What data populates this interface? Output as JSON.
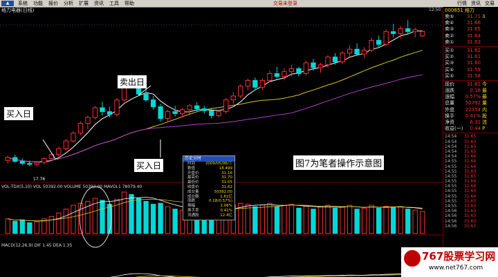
{
  "menu": {
    "items": [
      "系统",
      "功能",
      "报价",
      "分析",
      "扩展",
      "资讯",
      "工具",
      "帮助"
    ],
    "center_text": "交易未登录",
    "right": [
      "行情",
      "资讯",
      "交易"
    ]
  },
  "window": {
    "title": "格力电器(日线)",
    "time": "12:50"
  },
  "indicators": {
    "volume_label": "VOL-TDX(5,10)  VOL 50392.00  VOLUME 50392.00  MAVOL1 78079.40",
    "macd_label": "MACD(12,26,9)  DIF 1.45  DEA 1.35"
  },
  "annotations": {
    "buy1": "买入日",
    "sell": "卖出日",
    "buy2": "买入日",
    "caption": "图7为笔者操作示意图",
    "low_price": "17.76"
  },
  "quote_panel": {
    "code": "000651 格力",
    "rows": [
      {
        "label": "卖⑤",
        "value": "31.71",
        "vol": "3"
      },
      {
        "label": "卖④",
        "value": "31.66",
        "vol": ""
      },
      {
        "label": "卖③",
        "value": "31.65",
        "vol": ""
      },
      {
        "label": "卖②",
        "value": "31.64",
        "vol": ""
      },
      {
        "label": "卖①",
        "value": "31.63",
        "vol": ""
      },
      {
        "label": "买①",
        "value": "31.62",
        "vol": ""
      },
      {
        "label": "买②",
        "value": "31.61",
        "vol": ""
      },
      {
        "label": "买③",
        "value": "31.60",
        "vol": ""
      },
      {
        "label": "买④",
        "value": "31.59",
        "vol": ""
      },
      {
        "label": "买⑤",
        "value": "31.58",
        "vol": ""
      },
      {
        "label": "现价",
        "value": "31.62",
        "vol": "今"
      },
      {
        "label": "涨跌",
        "value": "0.18",
        "vol": "最"
      },
      {
        "label": "涨幅",
        "value": "0.57%",
        "vol": "最"
      },
      {
        "label": "总量",
        "value": "50392",
        "vol": "量"
      },
      {
        "label": "外盘",
        "value": "22354",
        "vol": "内"
      },
      {
        "label": "换手",
        "value": "0.41%",
        "vol": "股"
      },
      {
        "label": "净资",
        "value": "6.31",
        "vol": "流"
      },
      {
        "label": "收益(一)",
        "value": "0.44",
        "vol": "P"
      }
    ],
    "ticks": [
      {
        "time": "14:54",
        "price": "31.65"
      },
      {
        "time": "14:54",
        "price": "31.63"
      },
      {
        "time": "14:54",
        "price": "31.65"
      },
      {
        "time": "14:54",
        "price": "31.65"
      },
      {
        "time": "14:54",
        "price": "31.64"
      },
      {
        "time": "14:55",
        "price": "31.64"
      },
      {
        "time": "14:55",
        "price": "31.64"
      },
      {
        "time": "14:55",
        "price": "31.63"
      },
      {
        "time": "14:55",
        "price": "31.65"
      },
      {
        "time": "14:55",
        "price": "31.64"
      },
      {
        "time": "14:55",
        "price": "31.64"
      },
      {
        "time": "14:55",
        "price": "31.63"
      },
      {
        "time": "14:55",
        "price": "31.64"
      },
      {
        "time": "14:55",
        "price": "31.63"
      },
      {
        "time": "14:55",
        "price": "31.63"
      },
      {
        "time": "14:56",
        "price": "31.63"
      },
      {
        "time": "14:56",
        "price": "31.63"
      },
      {
        "time": "14:56",
        "price": "31.63"
      },
      {
        "time": "14:56",
        "price": "31.63"
      }
    ]
  },
  "popup": {
    "title": "历史分时",
    "rows": [
      {
        "label": "时间",
        "value": "2009/05/06/三"
      },
      {
        "label": "数值",
        "value": "18.499"
      },
      {
        "label": "开盘价",
        "value": "31.16"
      },
      {
        "label": "最高价",
        "value": "31.70"
      },
      {
        "label": "最低价",
        "value": "31.05"
      },
      {
        "label": "收盘价",
        "value": "31.62"
      },
      {
        "label": "成交量",
        "value": "50392.00"
      },
      {
        "label": "成交额",
        "value": "1.61亿"
      },
      {
        "label": "涨跌",
        "value": "0.18(0.57%)"
      },
      {
        "label": "振幅",
        "value": "2.06%"
      },
      {
        "label": "换手率",
        "value": "0.41%"
      },
      {
        "label": "流通股",
        "value": "12.4亿"
      }
    ]
  },
  "watermark": {
    "title": "767股票学习网",
    "url": "www.net767.com"
  },
  "colors": {
    "up": "#ff3030",
    "down": "#00d8d8",
    "ma_white": "#ffffff",
    "ma_yellow": "#d8c820",
    "ma_purple": "#b040d0"
  },
  "chart_data": {
    "type": "candlestick",
    "candles": [
      {
        "open": 18.4,
        "high": 18.9,
        "low": 18.1,
        "close": 18.7
      },
      {
        "open": 18.7,
        "high": 19.0,
        "low": 18.2,
        "close": 18.3
      },
      {
        "open": 18.3,
        "high": 18.6,
        "low": 17.9,
        "close": 18.1
      },
      {
        "open": 18.1,
        "high": 18.4,
        "low": 17.8,
        "close": 18.0
      },
      {
        "open": 18.0,
        "high": 18.3,
        "low": 17.76,
        "close": 18.2
      },
      {
        "open": 18.2,
        "high": 18.7,
        "low": 18.0,
        "close": 18.6
      },
      {
        "open": 18.6,
        "high": 19.2,
        "low": 18.4,
        "close": 19.0
      },
      {
        "open": 19.0,
        "high": 19.8,
        "low": 18.8,
        "close": 19.6
      },
      {
        "open": 19.6,
        "high": 20.6,
        "low": 19.4,
        "close": 20.4
      },
      {
        "open": 20.4,
        "high": 21.4,
        "low": 20.2,
        "close": 21.2
      },
      {
        "open": 21.2,
        "high": 22.4,
        "low": 21.0,
        "close": 22.2
      },
      {
        "open": 22.2,
        "high": 23.0,
        "low": 21.6,
        "close": 22.8
      },
      {
        "open": 22.8,
        "high": 24.0,
        "low": 22.6,
        "close": 23.8
      },
      {
        "open": 23.8,
        "high": 24.4,
        "low": 23.0,
        "close": 23.4
      },
      {
        "open": 23.4,
        "high": 23.9,
        "low": 22.8,
        "close": 23.1
      },
      {
        "open": 23.1,
        "high": 24.8,
        "low": 22.9,
        "close": 24.6
      },
      {
        "open": 24.6,
        "high": 26.6,
        "low": 24.4,
        "close": 26.3
      },
      {
        "open": 26.3,
        "high": 27.2,
        "low": 25.8,
        "close": 26.0
      },
      {
        "open": 26.0,
        "high": 26.4,
        "low": 25.0,
        "close": 25.2
      },
      {
        "open": 25.2,
        "high": 25.8,
        "low": 24.4,
        "close": 24.6
      },
      {
        "open": 24.6,
        "high": 25.0,
        "low": 23.6,
        "close": 23.9
      },
      {
        "open": 23.9,
        "high": 24.2,
        "low": 22.4,
        "close": 22.7
      },
      {
        "open": 22.7,
        "high": 23.6,
        "low": 22.4,
        "close": 23.4
      },
      {
        "open": 23.4,
        "high": 24.0,
        "low": 22.9,
        "close": 23.2
      },
      {
        "open": 23.2,
        "high": 23.8,
        "low": 22.8,
        "close": 23.6
      },
      {
        "open": 23.6,
        "high": 24.2,
        "low": 23.2,
        "close": 24.0
      },
      {
        "open": 24.0,
        "high": 24.4,
        "low": 23.4,
        "close": 23.7
      },
      {
        "open": 23.7,
        "high": 24.0,
        "low": 23.2,
        "close": 23.5
      },
      {
        "open": 23.5,
        "high": 23.8,
        "low": 22.7,
        "close": 23.0
      },
      {
        "open": 23.0,
        "high": 23.6,
        "low": 22.8,
        "close": 23.4
      },
      {
        "open": 23.4,
        "high": 24.8,
        "low": 23.2,
        "close": 24.6
      },
      {
        "open": 24.6,
        "high": 25.4,
        "low": 24.2,
        "close": 25.0
      },
      {
        "open": 25.0,
        "high": 26.2,
        "low": 24.8,
        "close": 26.0
      },
      {
        "open": 26.0,
        "high": 26.8,
        "low": 25.6,
        "close": 26.6
      },
      {
        "open": 26.6,
        "high": 26.9,
        "low": 25.6,
        "close": 25.9
      },
      {
        "open": 25.9,
        "high": 26.8,
        "low": 25.6,
        "close": 26.6
      },
      {
        "open": 26.6,
        "high": 27.6,
        "low": 26.4,
        "close": 27.3
      },
      {
        "open": 27.3,
        "high": 28.0,
        "low": 26.8,
        "close": 27.0
      },
      {
        "open": 27.0,
        "high": 27.8,
        "low": 26.6,
        "close": 27.5
      },
      {
        "open": 27.5,
        "high": 28.2,
        "low": 27.0,
        "close": 27.8
      },
      {
        "open": 27.8,
        "high": 28.0,
        "low": 27.0,
        "close": 27.3
      },
      {
        "open": 27.3,
        "high": 28.6,
        "low": 27.1,
        "close": 28.4
      },
      {
        "open": 28.4,
        "high": 28.8,
        "low": 27.6,
        "close": 27.9
      },
      {
        "open": 27.9,
        "high": 28.4,
        "low": 27.4,
        "close": 28.2
      },
      {
        "open": 28.2,
        "high": 29.2,
        "low": 27.9,
        "close": 29.0
      },
      {
        "open": 29.0,
        "high": 29.4,
        "low": 28.2,
        "close": 28.5
      },
      {
        "open": 28.5,
        "high": 29.6,
        "low": 28.3,
        "close": 29.4
      },
      {
        "open": 29.4,
        "high": 30.2,
        "low": 29.0,
        "close": 29.8
      },
      {
        "open": 29.8,
        "high": 30.4,
        "low": 29.1,
        "close": 29.3
      },
      {
        "open": 29.3,
        "high": 30.0,
        "low": 28.9,
        "close": 29.7
      },
      {
        "open": 29.7,
        "high": 31.0,
        "low": 29.5,
        "close": 30.7
      },
      {
        "open": 30.7,
        "high": 31.2,
        "low": 30.0,
        "close": 30.3
      },
      {
        "open": 30.3,
        "high": 31.8,
        "low": 30.1,
        "close": 31.6
      },
      {
        "open": 31.6,
        "high": 32.4,
        "low": 31.0,
        "close": 31.4
      },
      {
        "open": 31.4,
        "high": 32.2,
        "low": 30.9,
        "close": 31.9
      },
      {
        "open": 31.9,
        "high": 32.8,
        "low": 31.4,
        "close": 31.6
      },
      {
        "open": 31.6,
        "high": 32.0,
        "low": 31.0,
        "close": 31.8
      },
      {
        "open": 31.16,
        "high": 31.7,
        "low": 31.05,
        "close": 31.62
      }
    ],
    "volume": [
      30,
      25,
      28,
      22,
      24,
      30,
      35,
      42,
      50,
      58,
      62,
      66,
      72,
      68,
      60,
      70,
      85,
      80,
      72,
      66,
      60,
      62,
      55,
      50,
      48,
      52,
      50,
      46,
      44,
      48,
      55,
      58,
      62,
      60,
      55,
      58,
      62,
      55,
      58,
      60,
      52,
      56,
      50,
      54,
      58,
      52,
      55,
      58,
      50,
      52,
      58,
      52,
      56,
      54,
      55,
      50,
      48,
      45
    ],
    "ylim": [
      17.0,
      33.0
    ],
    "low_label_price": 17.76
  }
}
